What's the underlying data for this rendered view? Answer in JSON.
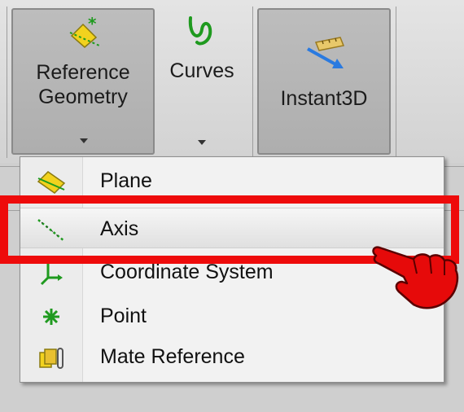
{
  "toolbar": {
    "reference_geometry": {
      "label": "Reference\nGeometry",
      "icon": "reference-geometry-icon"
    },
    "curves": {
      "label": "Curves",
      "icon": "curves-icon"
    },
    "instant3d": {
      "label": "Instant3D",
      "icon": "instant3d-icon"
    }
  },
  "menu": {
    "items": [
      {
        "label": "Plane",
        "icon": "plane-icon"
      },
      {
        "label": "Axis",
        "icon": "axis-icon"
      },
      {
        "label": "Coordinate System",
        "icon": "coordinate-system-icon"
      },
      {
        "label": "Point",
        "icon": "point-icon"
      },
      {
        "label": "Mate Reference",
        "icon": "mate-reference-icon"
      }
    ]
  },
  "colors": {
    "highlight_box": "#ee0b0b",
    "pointer_hand": "#e60a0a",
    "icon_green": "#1f9a1f",
    "icon_yellow": "#f2d21e"
  }
}
